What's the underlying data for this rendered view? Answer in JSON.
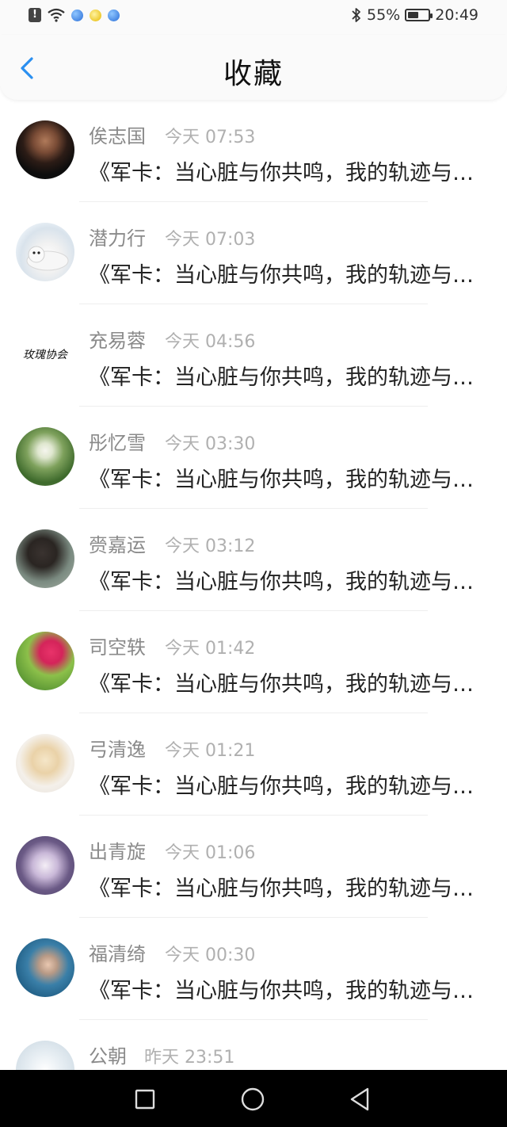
{
  "status_bar": {
    "battery": "55%",
    "battery_level": 0.55,
    "time": "20:49"
  },
  "header": {
    "title": "收藏"
  },
  "favorites": [
    {
      "name": "俟志国",
      "time": "今天 07:53",
      "preview": "《军卡：当心脏与你共鸣，我的轨迹与你同在》"
    },
    {
      "name": "潜力行",
      "time": "今天 07:03",
      "preview": "《军卡：当心脏与你共鸣，我的轨迹与你同在》"
    },
    {
      "name": "充易蓉",
      "time": "今天 04:56",
      "preview": "《军卡：当心脏与你共鸣，我的轨迹与你同在》",
      "avatar_text": "玫瑰协会"
    },
    {
      "name": "彤忆雪",
      "time": "今天 03:30",
      "preview": "《军卡：当心脏与你共鸣，我的轨迹与你同在》"
    },
    {
      "name": "赍嘉运",
      "time": "今天 03:12",
      "preview": "《军卡：当心脏与你共鸣，我的轨迹与你同在》"
    },
    {
      "name": "司空轶",
      "time": "今天 01:42",
      "preview": "《军卡：当心脏与你共鸣，我的轨迹与你同在》"
    },
    {
      "name": "弓清逸",
      "time": "今天 01:21",
      "preview": "《军卡：当心脏与你共鸣，我的轨迹与你同在》"
    },
    {
      "name": "出青旋",
      "time": "今天 01:06",
      "preview": "《军卡：当心脏与你共鸣，我的轨迹与你同在》"
    },
    {
      "name": "福清绮",
      "time": "今天 00:30",
      "preview": "《军卡：当心脏与你共鸣，我的轨迹与你同在》"
    },
    {
      "name": "公朝",
      "time": "昨天 23:51",
      "preview": ""
    }
  ],
  "colors": {
    "accent_blue": "#2a8ff0",
    "name_gray": "#8a8a8a",
    "time_gray": "#b0b0b0"
  },
  "icons": {
    "back": "chevron-left-icon",
    "nav_recent": "square-icon",
    "nav_home": "circle-icon",
    "nav_back": "triangle-back-icon"
  }
}
